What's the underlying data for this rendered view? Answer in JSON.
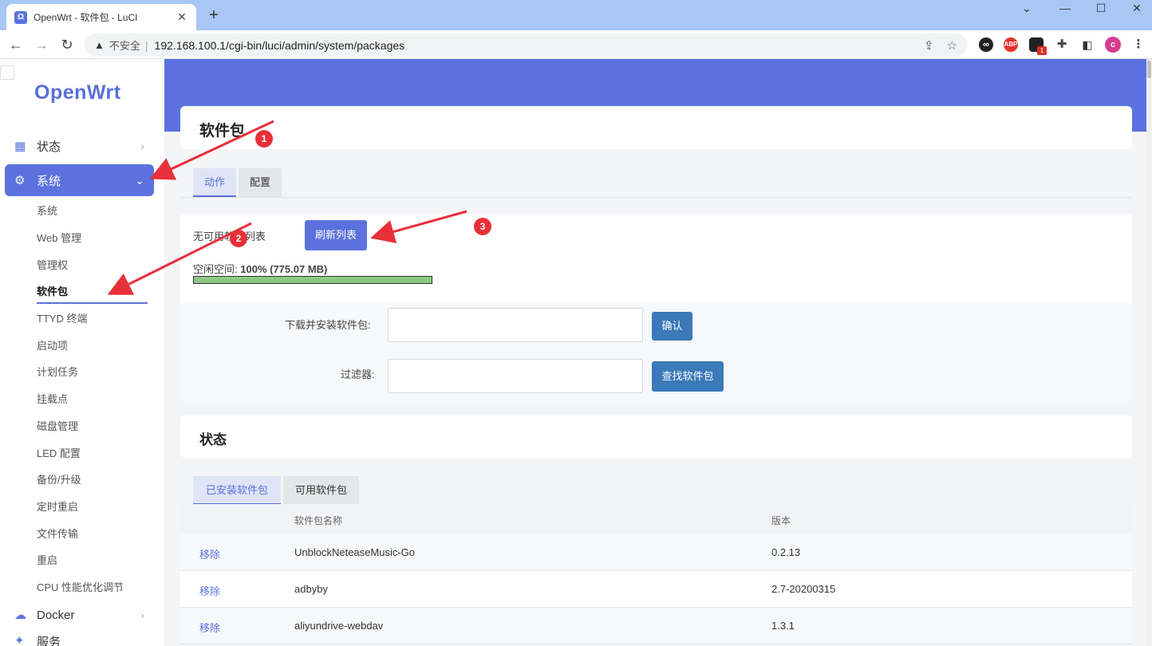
{
  "browser": {
    "tab_title": "OpenWrt - 软件包 - LuCI",
    "favicon": "Ω",
    "tab_close": "✕",
    "new_tab": "+",
    "insecure_label": "不安全",
    "url": "192.168.100.1/cgi-bin/luci/admin/system/packages",
    "extensions": [
      "ABP"
    ],
    "ext_badge": "1",
    "profile_initial": "c"
  },
  "sidebar": {
    "logo": "OpenWrt",
    "top_items": [
      {
        "label": "状态",
        "icon": "dashboard-icon"
      },
      {
        "label": "系统",
        "icon": "gear-icon",
        "active": true
      },
      {
        "label": "Docker",
        "icon": "docker-icon"
      },
      {
        "label": "服务",
        "icon": "services-icon"
      }
    ],
    "sub_items": [
      {
        "label": "系统"
      },
      {
        "label": "Web 管理"
      },
      {
        "label": "管理权"
      },
      {
        "label": "软件包",
        "current": true
      },
      {
        "label": "TTYD 终端"
      },
      {
        "label": "启动项"
      },
      {
        "label": "计划任务"
      },
      {
        "label": "挂载点"
      },
      {
        "label": "磁盘管理"
      },
      {
        "label": "LED 配置"
      },
      {
        "label": "备份/升级"
      },
      {
        "label": "定时重启"
      },
      {
        "label": "文件传输"
      },
      {
        "label": "重启"
      },
      {
        "label": "CPU 性能优化调节"
      }
    ]
  },
  "page": {
    "title": "软件包",
    "tabs": [
      {
        "label": "动作",
        "active": true
      },
      {
        "label": "配置"
      }
    ],
    "actions": {
      "no_list_text": "无可用软件列表",
      "refresh_button": "刷新列表",
      "free_space_label": "空闲空间:",
      "free_space_value": "100% (775.07 MB)",
      "free_space_fraction": 1.0,
      "download_label": "下载并安装软件包:",
      "download_value": "",
      "confirm_button": "确认",
      "filter_label": "过滤器:",
      "filter_value": "",
      "find_button": "查找软件包"
    },
    "status": {
      "title": "状态",
      "tabs": [
        {
          "label": "已安装软件包",
          "active": true
        },
        {
          "label": "可用软件包"
        }
      ],
      "columns": [
        "软件包名称",
        "版本"
      ],
      "rows": [
        {
          "action": "移除",
          "name": "UnblockNeteaseMusic-Go",
          "version": "0.2.13"
        },
        {
          "action": "移除",
          "name": "adbyby",
          "version": "2.7-20200315"
        },
        {
          "action": "移除",
          "name": "aliyundrive-webdav",
          "version": "1.3.1"
        }
      ]
    }
  },
  "annotations": [
    "1",
    "2",
    "3"
  ],
  "colors": {
    "accent": "#5b72de",
    "blue_button": "#3a7ab8",
    "annotation": "#e8303a",
    "progress": "#8dcb82"
  }
}
